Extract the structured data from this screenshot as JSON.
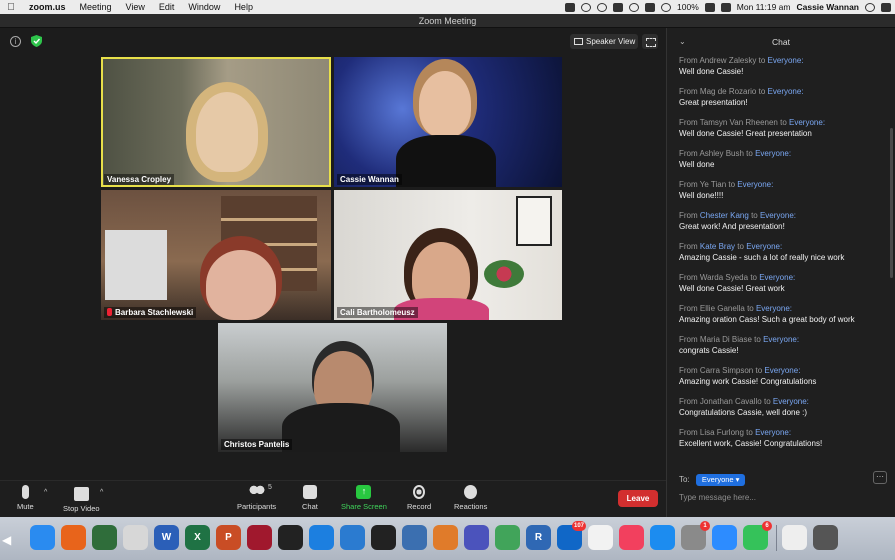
{
  "menubar": {
    "app": "zoom.us",
    "items": [
      "Meeting",
      "View",
      "Edit",
      "Window",
      "Help"
    ],
    "battery": "100%",
    "clock": "Mon 11:19 am",
    "user": "Cassie Wannan"
  },
  "window": {
    "title": "Zoom Meeting"
  },
  "meeting": {
    "speaker_view_label": "Speaker View",
    "participants": [
      {
        "name": "Vanessa Cropley",
        "active": true
      },
      {
        "name": "Cassie Wannan"
      },
      {
        "name": "Barbara Stachlewski",
        "muted": true
      },
      {
        "name": "Cali Bartholomeusz"
      },
      {
        "name": "Christos Pantelis"
      }
    ]
  },
  "toolbar": {
    "mute": "Mute",
    "stop_video": "Stop Video",
    "participants": "Participants",
    "participants_count": "5",
    "chat": "Chat",
    "share_screen": "Share Screen",
    "record": "Record",
    "reactions": "Reactions",
    "leave": "Leave"
  },
  "chat": {
    "title": "Chat",
    "from_word": "From",
    "to_word": "to",
    "everyone": "Everyone:",
    "messages": [
      {
        "from": "Andrew Zalesky",
        "text": "Well done Cassie!"
      },
      {
        "from": "Mag de Rozario",
        "text": "Great presentation!"
      },
      {
        "from": "Tamsyn Van Rheenen",
        "text": "Well done Cassie! Great presentation"
      },
      {
        "from": "Ashley Bush",
        "text": "Well done"
      },
      {
        "from": "Ye Tian",
        "text": "Well done!!!!"
      },
      {
        "from": "Chester Kang",
        "text": "Great work! And presentation!",
        "highlight": true
      },
      {
        "from": "Kate Bray",
        "text": "Amazing Cassie - such a lot of really nice work",
        "highlight": true
      },
      {
        "from": "Warda Syeda",
        "text": "Well done Cassie! Great work"
      },
      {
        "from": "Ellie Ganella",
        "text": "Amazing oration Cass! Such a great body of work"
      },
      {
        "from": "Maria Di Biase",
        "text": "congrats Cassie!"
      },
      {
        "from": "Carra Simpson",
        "text": "Amazing work Cassie! Congratulations"
      },
      {
        "from": "Jonathan Cavallo",
        "text": "Congratulations Cassie, well done :)"
      },
      {
        "from": "Lisa Furlong",
        "text": "Excellent work, Cassie! Congratulations!"
      }
    ],
    "to_label": "To:",
    "to_value": "Everyone",
    "input_placeholder": "Type message here..."
  },
  "dock": {
    "apps": [
      {
        "name": "finder",
        "color": "#2a8bf0"
      },
      {
        "name": "firefox",
        "color": "#e8641b"
      },
      {
        "name": "photo-booth",
        "color": "#2f6d3a"
      },
      {
        "name": "preview",
        "color": "#d7d7d7"
      },
      {
        "name": "word",
        "color": "#2b5fb8",
        "label": "W"
      },
      {
        "name": "excel",
        "color": "#1f7244",
        "label": "X"
      },
      {
        "name": "powerpoint",
        "color": "#c94d25",
        "label": "P"
      },
      {
        "name": "mendeley",
        "color": "#a0182d"
      },
      {
        "name": "acrobat",
        "color": "#222"
      },
      {
        "name": "safari",
        "color": "#1c7fe0"
      },
      {
        "name": "spss",
        "color": "#2b7bd0"
      },
      {
        "name": "terminal",
        "color": "#222"
      },
      {
        "name": "photos-app",
        "color": "#3b6fb0"
      },
      {
        "name": "matlab",
        "color": "#e07b2a"
      },
      {
        "name": "teams",
        "color": "#4b53bc"
      },
      {
        "name": "maps",
        "color": "#41a45a"
      },
      {
        "name": "r",
        "color": "#2f68b4",
        "label": "R"
      },
      {
        "name": "outlook",
        "color": "#1067c7",
        "badge": "107"
      },
      {
        "name": "photos",
        "color": "#f2f2f2"
      },
      {
        "name": "music",
        "color": "#f2405e"
      },
      {
        "name": "app-store",
        "color": "#1c8cf0"
      },
      {
        "name": "system-preferences",
        "color": "#8a8a8a",
        "badge": "1"
      },
      {
        "name": "zoom",
        "color": "#2d8cff"
      },
      {
        "name": "messages",
        "color": "#35c25a",
        "badge": "6"
      },
      {
        "name": "documents",
        "color": "#eee"
      },
      {
        "name": "trash",
        "color": "#555"
      }
    ]
  }
}
